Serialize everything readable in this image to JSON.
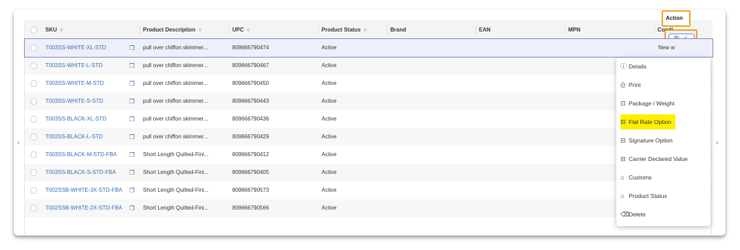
{
  "table": {
    "columns": [
      {
        "label": "SKU",
        "sortable": true
      },
      {
        "label": "Product Description",
        "sortable": true
      },
      {
        "label": "UPC",
        "sortable": true
      },
      {
        "label": "Product Status",
        "sortable": true
      },
      {
        "label": "Brand",
        "sortable": false
      },
      {
        "label": "EAN",
        "sortable": false
      },
      {
        "label": "MPN",
        "sortable": false
      },
      {
        "label": "Condi",
        "sortable": false
      }
    ],
    "sort_glyph": "≑",
    "action_header": "Action",
    "rows": [
      {
        "sku": "T003SS-WHITE-XL-STD",
        "description": "pull over chiffon skimmer...",
        "upc": "809666790474",
        "status": "Active",
        "condition": "New w"
      },
      {
        "sku": "T003SS-WHITE-L-STD",
        "description": "pull over chiffon skimmer...",
        "upc": "809666790467",
        "status": "Active",
        "condition": ""
      },
      {
        "sku": "T003SS-WHITE-M-STD",
        "description": "pull over chiffon skimmer...",
        "upc": "809666790450",
        "status": "Active",
        "condition": ""
      },
      {
        "sku": "T003SS-WHITE-S-STD",
        "description": "pull over chiffon skimmer...",
        "upc": "809666790443",
        "status": "Active",
        "condition": ""
      },
      {
        "sku": "T003SS-BLACK-XL-STD",
        "description": "pull over chiffon skimmer...",
        "upc": "809666790436",
        "status": "Active",
        "condition": ""
      },
      {
        "sku": "T003SS-BLACK-L-STD",
        "description": "pull over chiffon skimmer...",
        "upc": "809666790429",
        "status": "Active",
        "condition": ""
      },
      {
        "sku": "T003SS-BLACK-M-STD-FBA",
        "description": "Short Length Quilted-Fini...",
        "upc": "809666790412",
        "status": "Active",
        "condition": ""
      },
      {
        "sku": "T003SS-BLACK-S-STD-FBA",
        "description": "Short Length Quilted-Fini...",
        "upc": "809666790405",
        "status": "Active",
        "condition": ""
      },
      {
        "sku": "T002SSB-WHITE-3X-STD-FBA",
        "description": "Short Length Quilted-Fini...",
        "upc": "809666790573",
        "status": "Active",
        "condition": ""
      },
      {
        "sku": "T002SSB-WHITE-2X-STD-FBA",
        "description": "Short Length Quilted-Fini...",
        "upc": "809666790566",
        "status": "Active",
        "condition": ""
      }
    ]
  },
  "action_menu": {
    "items": [
      {
        "label": "Details",
        "icon": "info-circle-icon",
        "glyph": "ⓘ"
      },
      {
        "label": "Print",
        "icon": "printer-icon",
        "glyph": "⎙"
      },
      {
        "label": "Package / Weight",
        "icon": "package-icon",
        "glyph": "⊡"
      },
      {
        "label": "Flat Rate Option",
        "icon": "flat-rate-icon",
        "glyph": "⊟",
        "highlighted": true
      },
      {
        "label": "Signature Option",
        "icon": "signature-icon",
        "glyph": "⊟"
      },
      {
        "label": "Carrier Declared Value",
        "icon": "carrier-value-icon",
        "glyph": "⊟"
      },
      {
        "label": "Customs",
        "icon": "customs-building-icon",
        "glyph": "⌂"
      },
      {
        "label": "Product Status",
        "icon": "status-building-icon",
        "glyph": "⌂"
      },
      {
        "label": "Delete",
        "icon": "trash-icon",
        "glyph": "⌫"
      }
    ]
  },
  "icons": {
    "copy": "❐",
    "gear": "⚙",
    "hand_cursor": "☝",
    "scroll_left": "‹",
    "scroll_right": "›"
  },
  "colors": {
    "link": "#2f6fb5",
    "highlight": "#ffef00",
    "callout_border": "#f0a020",
    "selected_row_border": "#7b86c9"
  }
}
